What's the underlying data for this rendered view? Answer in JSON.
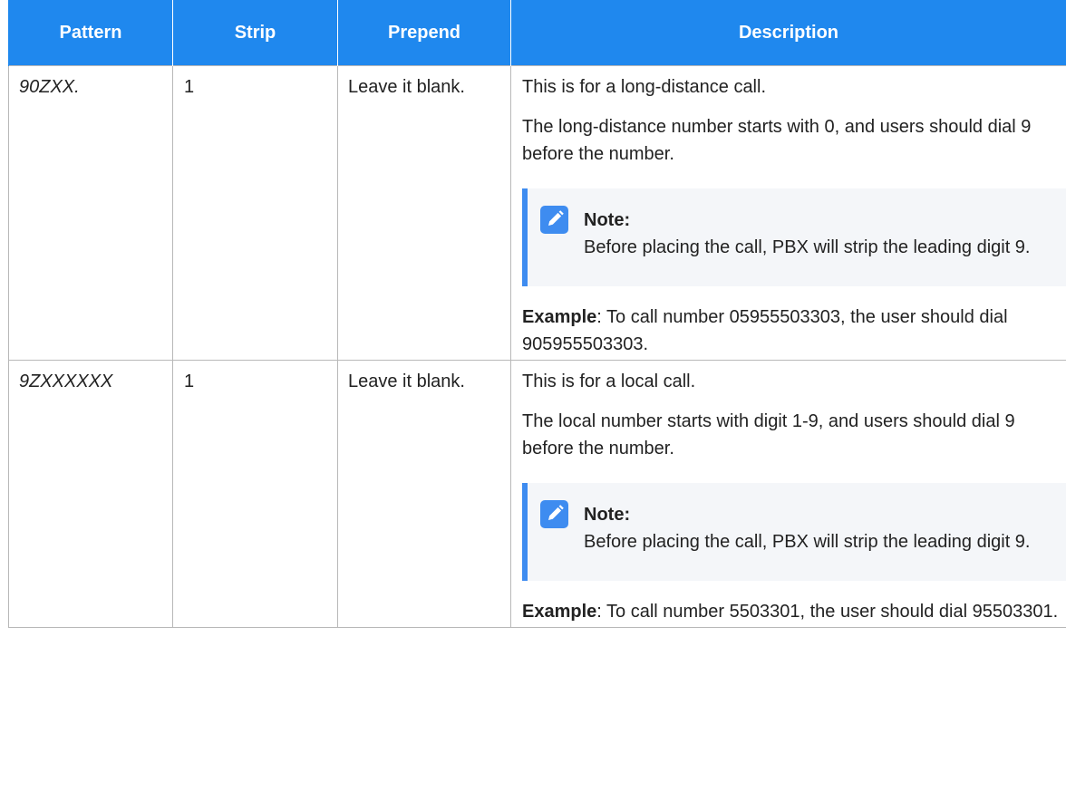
{
  "table": {
    "headers": [
      "Pattern",
      "Strip",
      "Prepend",
      "Description"
    ],
    "rows": [
      {
        "pattern": "90ZXX.",
        "strip": "1",
        "prepend": "Leave it blank.",
        "intro": "This is for a long-distance call.",
        "detail": "The long-distance number starts with 0, and users should dial 9 before the number.",
        "note_title": "Note:",
        "note_text": "Before placing the call, PBX will strip the leading digit 9.",
        "example_label": "Example",
        "example_text": ": To call number 05955503303, the user should dial 905955503303."
      },
      {
        "pattern": "9ZXXXXXX",
        "strip": "1",
        "prepend": "Leave it blank.",
        "intro": "This is for a local call.",
        "detail": "The local number starts with digit 1-9, and users should dial 9 before the number.",
        "note_title": "Note:",
        "note_text": "Before placing the call, PBX will strip the leading digit 9.",
        "example_label": "Example",
        "example_text": ": To call number 5503301, the user should dial 95503301."
      }
    ]
  },
  "icons": {
    "note_icon": "pencil-icon"
  },
  "colors": {
    "header_bg": "#1f88ee",
    "header_text": "#ffffff",
    "note_accent": "#3e8cf0",
    "note_bg": "#f4f6f9",
    "border": "#b8b8b8"
  }
}
